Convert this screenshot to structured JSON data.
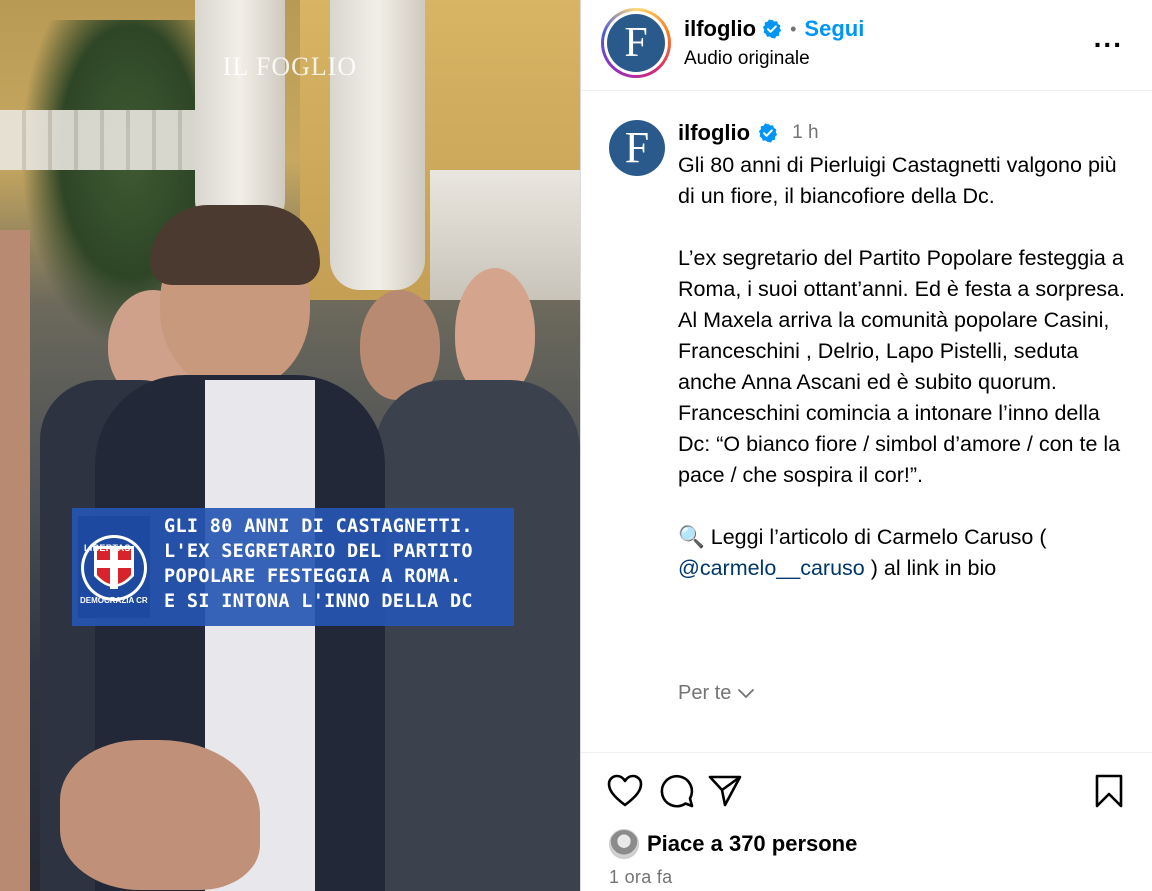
{
  "video": {
    "watermark": "IL FOGLIO",
    "caption_lines": [
      "GLI 80 ANNI DI CASTAGNETTI.",
      "L'EX SEGRETARIO DEL PARTITO",
      "POPOLARE FESTEGGIA A ROMA.",
      "E SI INTONA L'INNO DELLA DC"
    ],
    "logo_top_text": "LIBERTAS",
    "logo_bottom_text": "DEMOCRAZIA CRISTIANA",
    "caption_bg": "#2656b2"
  },
  "header": {
    "avatar_letter": "F",
    "username": "ilfoglio",
    "separator": "•",
    "follow_label": "Segui",
    "audio_label": "Audio originale",
    "more_label": "..."
  },
  "comment": {
    "avatar_letter": "F",
    "username": "ilfoglio",
    "time": "1 h",
    "paragraph1": "Gli 80 anni di Pierluigi Castagnetti valgono più di un fiore, il biancofiore della Dc.",
    "paragraph2": "L’ex segretario del Partito Popolare festeggia a Roma, i suoi ottant’anni. Ed è festa a sorpresa. Al Maxela arriva la comunità popolare Casini, Franceschini , Delrio, Lapo Pistelli, seduta anche Anna Ascani ed è subito quorum. Franceschini comincia a intonare l’inno della Dc: “O bianco fiore / simbol d’amore / con te la pace / che sospira il cor!”.",
    "link_prefix": "🔍 Leggi l’articolo di Carmelo Caruso (",
    "mention": "@carmelo__caruso",
    "link_suffix": " ) al link in bio",
    "for_you_label": "Per te"
  },
  "actions": {
    "likes_text": "Piace a 370 persone",
    "posted_time": "1 ora fa"
  },
  "colors": {
    "accent": "#0095f6",
    "mention": "#00376b",
    "muted": "#737373",
    "brand_avatar": "#2a5a8c"
  },
  "icons": [
    "verified-badge-icon",
    "more-options-icon",
    "chevron-down-icon",
    "heart-icon",
    "comment-icon",
    "share-icon",
    "bookmark-icon"
  ]
}
